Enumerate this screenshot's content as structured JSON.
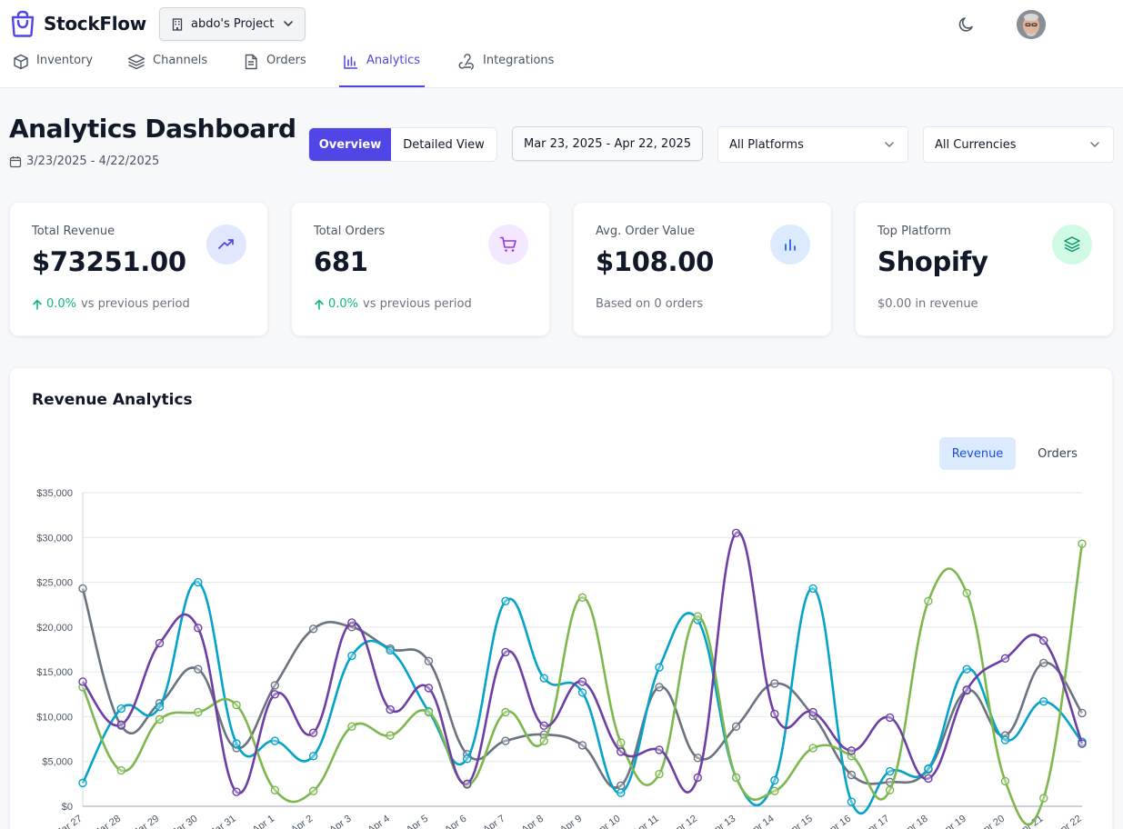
{
  "app": {
    "name": "StockFlow",
    "project": "abdo's Project"
  },
  "nav": [
    {
      "label": "Inventory",
      "icon": "box-icon"
    },
    {
      "label": "Channels",
      "icon": "layers-icon"
    },
    {
      "label": "Orders",
      "icon": "document-icon"
    },
    {
      "label": "Analytics",
      "icon": "bar-chart-icon",
      "active": true
    },
    {
      "label": "Integrations",
      "icon": "webhook-icon"
    }
  ],
  "header": {
    "title": "Analytics Dashboard",
    "date_range_text": "3/23/2025 - 4/22/2025",
    "view_overview": "Overview",
    "view_detailed": "Detailed View",
    "date_picker": "Mar 23, 2025 - Apr 22, 2025",
    "platform_select": "All Platforms",
    "currency_select": "All Currencies"
  },
  "stats": [
    {
      "label": "Total Revenue",
      "value": "$73251.00",
      "change": "0.0%",
      "suffix": "vs previous period",
      "icon": "trending-up-icon",
      "icon_bg": "#e0e7ff",
      "icon_color": "#4f46e5"
    },
    {
      "label": "Total Orders",
      "value": "681",
      "change": "0.0%",
      "suffix": "vs previous period",
      "icon": "cart-icon",
      "icon_bg": "#f3e8ff",
      "icon_color": "#9333ea"
    },
    {
      "label": "Avg. Order Value",
      "value": "$108.00",
      "subtext": "Based on 0 orders",
      "icon": "bar-chart-icon",
      "icon_bg": "#dbeafe",
      "icon_color": "#2563eb"
    },
    {
      "label": "Top Platform",
      "value": "Shopify",
      "subtext": "$0.00 in revenue",
      "icon": "layers-icon",
      "icon_bg": "#d1fae5",
      "icon_color": "#059669"
    }
  ],
  "revenue_panel": {
    "title": "Revenue Analytics",
    "toggle_revenue": "Revenue",
    "toggle_orders": "Orders"
  },
  "colors": {
    "accent": "#4f46e5",
    "positive": "#10b981"
  },
  "chart_data": {
    "type": "line",
    "categories": [
      "Mar 27",
      "Mar 28",
      "Mar 29",
      "Mar 30",
      "Mar 31",
      "Apr 1",
      "Apr 2",
      "Apr 3",
      "Apr 4",
      "Apr 5",
      "Apr 6",
      "Apr 7",
      "Apr 8",
      "Apr 9",
      "Apr 10",
      "Apr 11",
      "Apr 12",
      "Apr 13",
      "Apr 14",
      "Apr 15",
      "Apr 16",
      "Apr 17",
      "Apr 18",
      "Apr 19",
      "Apr 20",
      "Apr 21",
      "Apr 22"
    ],
    "y_ticks": [
      "$0",
      "$5,000",
      "$10,000",
      "$15,000",
      "$20,000",
      "$25,000",
      "$30,000",
      "$35,000"
    ],
    "ylim": [
      0,
      35000
    ],
    "grid": true,
    "series": [
      {
        "color": "#6b7280",
        "values": [
          24300,
          9000,
          11500,
          15300,
          6500,
          13500,
          19800,
          20000,
          17600,
          16200,
          5800,
          7300,
          8000,
          6800,
          2300,
          13300,
          5400,
          8900,
          13700,
          10100,
          3500,
          2700,
          4100,
          12900,
          7900,
          16000,
          10400
        ]
      },
      {
        "color": "#06a3c9",
        "values": [
          2600,
          10900,
          11100,
          25000,
          7000,
          7300,
          5600,
          16800,
          17400,
          10600,
          5300,
          22900,
          14300,
          12700,
          1500,
          15500,
          20800,
          3200,
          2900,
          24300,
          500,
          3900,
          4200,
          15300,
          7400,
          11700,
          7200
        ]
      },
      {
        "color": "#7cb84f",
        "values": [
          13300,
          4000,
          9700,
          10500,
          11300,
          1800,
          1700,
          8900,
          7900,
          10500,
          2400,
          10500,
          7300,
          23300,
          7100,
          3600,
          21200,
          3200,
          1700,
          6500,
          5600,
          1800,
          22900,
          23800,
          2800,
          900,
          29300
        ]
      },
      {
        "color": "#6d3fa5",
        "values": [
          13900,
          9100,
          18200,
          19900,
          1600,
          12500,
          8200,
          20500,
          10800,
          13200,
          2500,
          17200,
          9000,
          13900,
          6100,
          6300,
          3200,
          30500,
          10300,
          10500,
          6200,
          9900,
          3100,
          13000,
          16500,
          18500,
          7000
        ]
      }
    ]
  }
}
